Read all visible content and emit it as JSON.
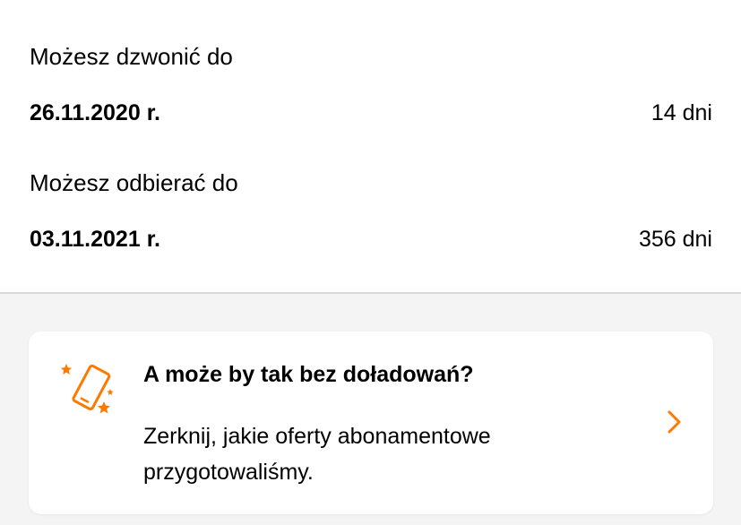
{
  "validity": {
    "call": {
      "label": "Możesz dzwonić do",
      "date": "26.11.2020 r.",
      "days": "14 dni"
    },
    "receive": {
      "label": "Możesz odbierać do",
      "date": "03.11.2021 r.",
      "days": "356 dni"
    }
  },
  "promo": {
    "title": "A może by tak bez doładowań?",
    "description": "Zerknij, jakie oferty abonamentowe przygotowaliśmy.",
    "icon": "phone-sparkle-icon",
    "chevron_icon": "chevron-right-icon"
  },
  "colors": {
    "accent": "#ff7900",
    "background": "#f4f4f4",
    "divider": "#d9d9d9"
  }
}
